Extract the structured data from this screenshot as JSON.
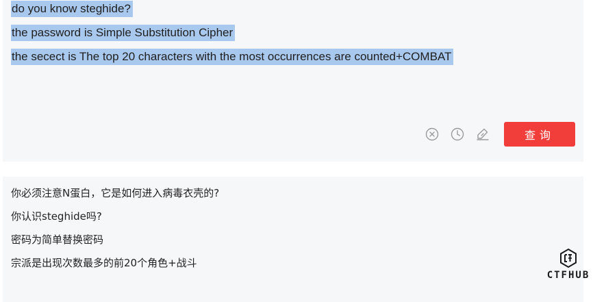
{
  "input": {
    "lines": [
      "do you know steghide?",
      "the password is Simple Substitution Cipher",
      "the secect is The top 20 characters with the most occurrences are counted+COMBAT"
    ]
  },
  "toolbar": {
    "clear_icon": "circle-x-icon",
    "history_icon": "clock-icon",
    "feedback_icon": "edit-sign-icon",
    "query_label": "查询"
  },
  "output": {
    "lines": [
      "你必须注意N蛋白，它是如何进入病毒衣壳的?",
      "你认识steghide吗?",
      "密码为简单替换密码",
      "宗派是出现次数最多的前20个角色+战斗"
    ]
  },
  "logo": {
    "text": "CTFHUB"
  },
  "colors": {
    "panel_bg": "#f6f7f9",
    "selection": "#a9c8ee",
    "query_button": "#f23e3b"
  }
}
